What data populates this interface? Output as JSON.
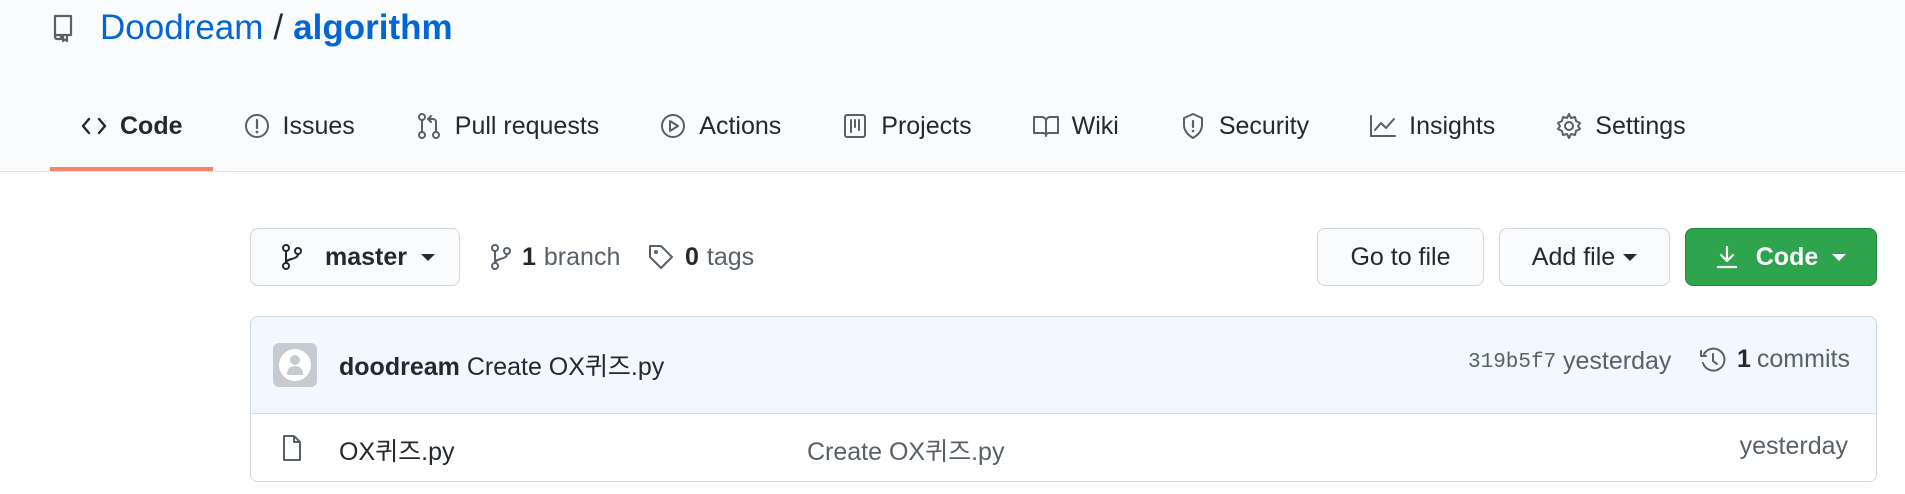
{
  "repo": {
    "owner": "Doodream",
    "separator": "/",
    "name": "algorithm"
  },
  "tabs": [
    {
      "label": "Code",
      "icon": "code-icon",
      "selected": true
    },
    {
      "label": "Issues",
      "icon": "issue-icon"
    },
    {
      "label": "Pull requests",
      "icon": "pull-request-icon"
    },
    {
      "label": "Actions",
      "icon": "play-icon"
    },
    {
      "label": "Projects",
      "icon": "project-icon"
    },
    {
      "label": "Wiki",
      "icon": "book-icon"
    },
    {
      "label": "Security",
      "icon": "shield-icon"
    },
    {
      "label": "Insights",
      "icon": "graph-icon"
    },
    {
      "label": "Settings",
      "icon": "gear-icon"
    }
  ],
  "toolbar": {
    "branch": "master",
    "branch_count": "1",
    "branch_label": "branch",
    "tag_count": "0",
    "tag_label": "tags",
    "go_to_file": "Go to file",
    "add_file": "Add file",
    "code": "Code"
  },
  "commit": {
    "author": "doodream",
    "message": "Create OX퀴즈.py",
    "sha": "319b5f7",
    "time": "yesterday",
    "commit_count": "1",
    "commit_label": "commits"
  },
  "files": [
    {
      "name": "OX퀴즈.py",
      "message": "Create OX퀴즈.py",
      "age": "yesterday"
    }
  ],
  "colors": {
    "accent": "#0366d6",
    "selected_tab_underline": "#f9826c",
    "code_button": "#2ea44f"
  }
}
